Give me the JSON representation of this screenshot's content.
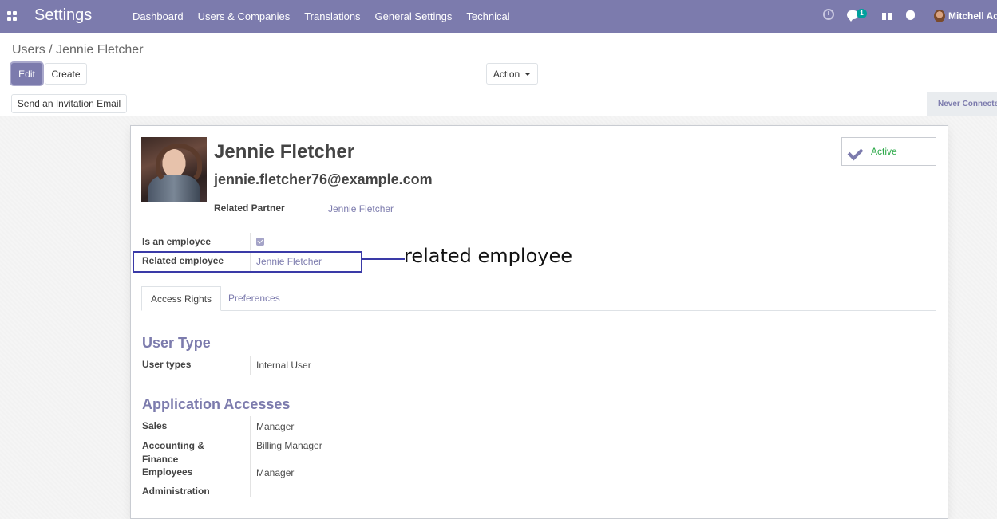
{
  "navbar": {
    "brand": "Settings",
    "menu": [
      "Dashboard",
      "Users & Companies",
      "Translations",
      "General Settings",
      "Technical"
    ],
    "chat_badge": "1",
    "user": "Mitchell Adr"
  },
  "control_panel": {
    "breadcrumb_parent": "Users",
    "breadcrumb_sep": " / ",
    "breadcrumb_current": "Jennie Fletcher",
    "edit_label": "Edit",
    "create_label": "Create",
    "action_label": "Action"
  },
  "statusbar": {
    "invite_label": "Send an Invitation Email",
    "status": "Never Connected"
  },
  "form": {
    "name": "Jennie Fletcher",
    "login": "jennie.fletcher76@example.com",
    "active_label": "Active",
    "related_partner_label": "Related Partner",
    "related_partner_value": "Jennie Fletcher",
    "is_employee_label": "Is an employee",
    "is_employee_checked": true,
    "related_employee_label": "Related employee",
    "related_employee_value": "Jennie Fletcher",
    "annotation": "related employee",
    "tabs": [
      "Access Rights",
      "Preferences"
    ],
    "user_type_title": "User Type",
    "user_types_label": "User types",
    "user_types_value": "Internal User",
    "app_access_title": "Application Accesses",
    "accesses": [
      {
        "label": "Sales",
        "value": "Manager"
      },
      {
        "label": "Accounting & Finance",
        "value": "Billing Manager"
      },
      {
        "label": "Employees",
        "value": "Manager"
      },
      {
        "label": "Administration",
        "value": ""
      }
    ]
  },
  "colors": {
    "brand": "#7c7bad",
    "active": "#28a745",
    "annotation": "#3a3aa7"
  }
}
